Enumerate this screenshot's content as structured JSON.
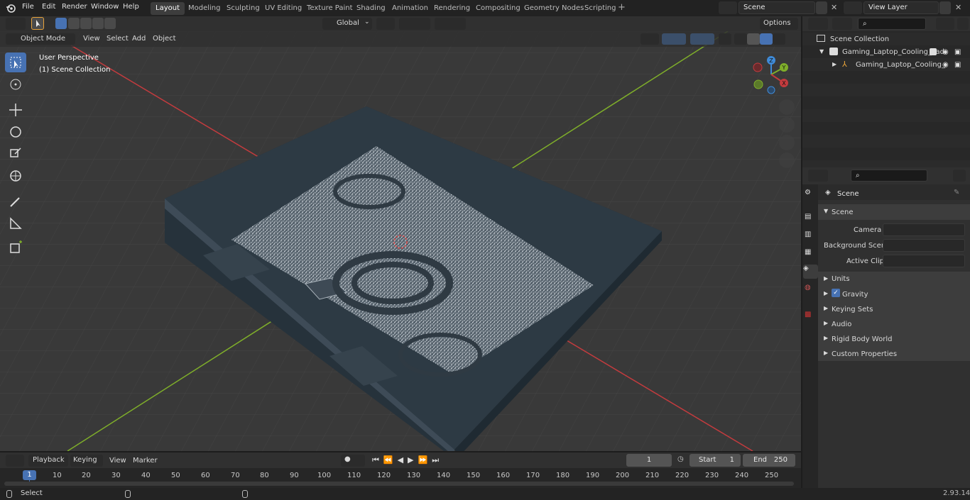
{
  "top_menu": [
    "File",
    "Edit",
    "Render",
    "Window",
    "Help"
  ],
  "workspaces": [
    "Layout",
    "Modeling",
    "Sculpting",
    "UV Editing",
    "Texture Paint",
    "Shading",
    "Animation",
    "Rendering",
    "Compositing",
    "Geometry Nodes",
    "Scripting"
  ],
  "scene_field": "Scene",
  "view_layer_field": "View Layer",
  "header": {
    "transform_orientation": "Global",
    "options_label": "Options",
    "mode": "Object Mode",
    "view": "View",
    "select": "Select",
    "add": "Add",
    "object": "Object"
  },
  "viewport": {
    "perspective_label": "User Perspective",
    "collection_label": "(1) Scene Collection",
    "gizmo_axes": [
      "Z",
      "Y",
      "X"
    ]
  },
  "outliner": {
    "root": "Scene Collection",
    "items": [
      {
        "label": "Gaming_Laptop_Cooling_Pad"
      },
      {
        "label": "Gaming_Laptop_Cooling_"
      }
    ]
  },
  "properties": {
    "title": "Scene",
    "section": "Scene",
    "fields": [
      {
        "label": "Camera"
      },
      {
        "label": "Background Scene"
      },
      {
        "label": "Active Clip"
      }
    ],
    "panels": [
      "Units",
      "Gravity",
      "Keying Sets",
      "Audio",
      "Rigid Body World",
      "Custom Properties"
    ],
    "gravity_checked": true
  },
  "timeline": {
    "playback": "Playback",
    "keying": "Keying",
    "view": "View",
    "marker": "Marker",
    "current_frame": "1",
    "start_label": "Start",
    "start_value": "1",
    "end_label": "End",
    "end_value": "250",
    "ruler_current": "1",
    "ruler_ticks": [
      "10",
      "20",
      "30",
      "40",
      "50",
      "60",
      "70",
      "80",
      "90",
      "100",
      "110",
      "120",
      "130",
      "140",
      "150",
      "160",
      "170",
      "180",
      "190",
      "200",
      "210",
      "220",
      "230",
      "240",
      "250"
    ]
  },
  "status": {
    "left_label": "Select",
    "version": "2.93.14"
  },
  "colors": {
    "accent": "#4772b3",
    "x_axis": "#c33b3e",
    "y_axis": "#7fae2a",
    "z_axis": "#3f8bd8",
    "pad": "#2d3a44"
  }
}
